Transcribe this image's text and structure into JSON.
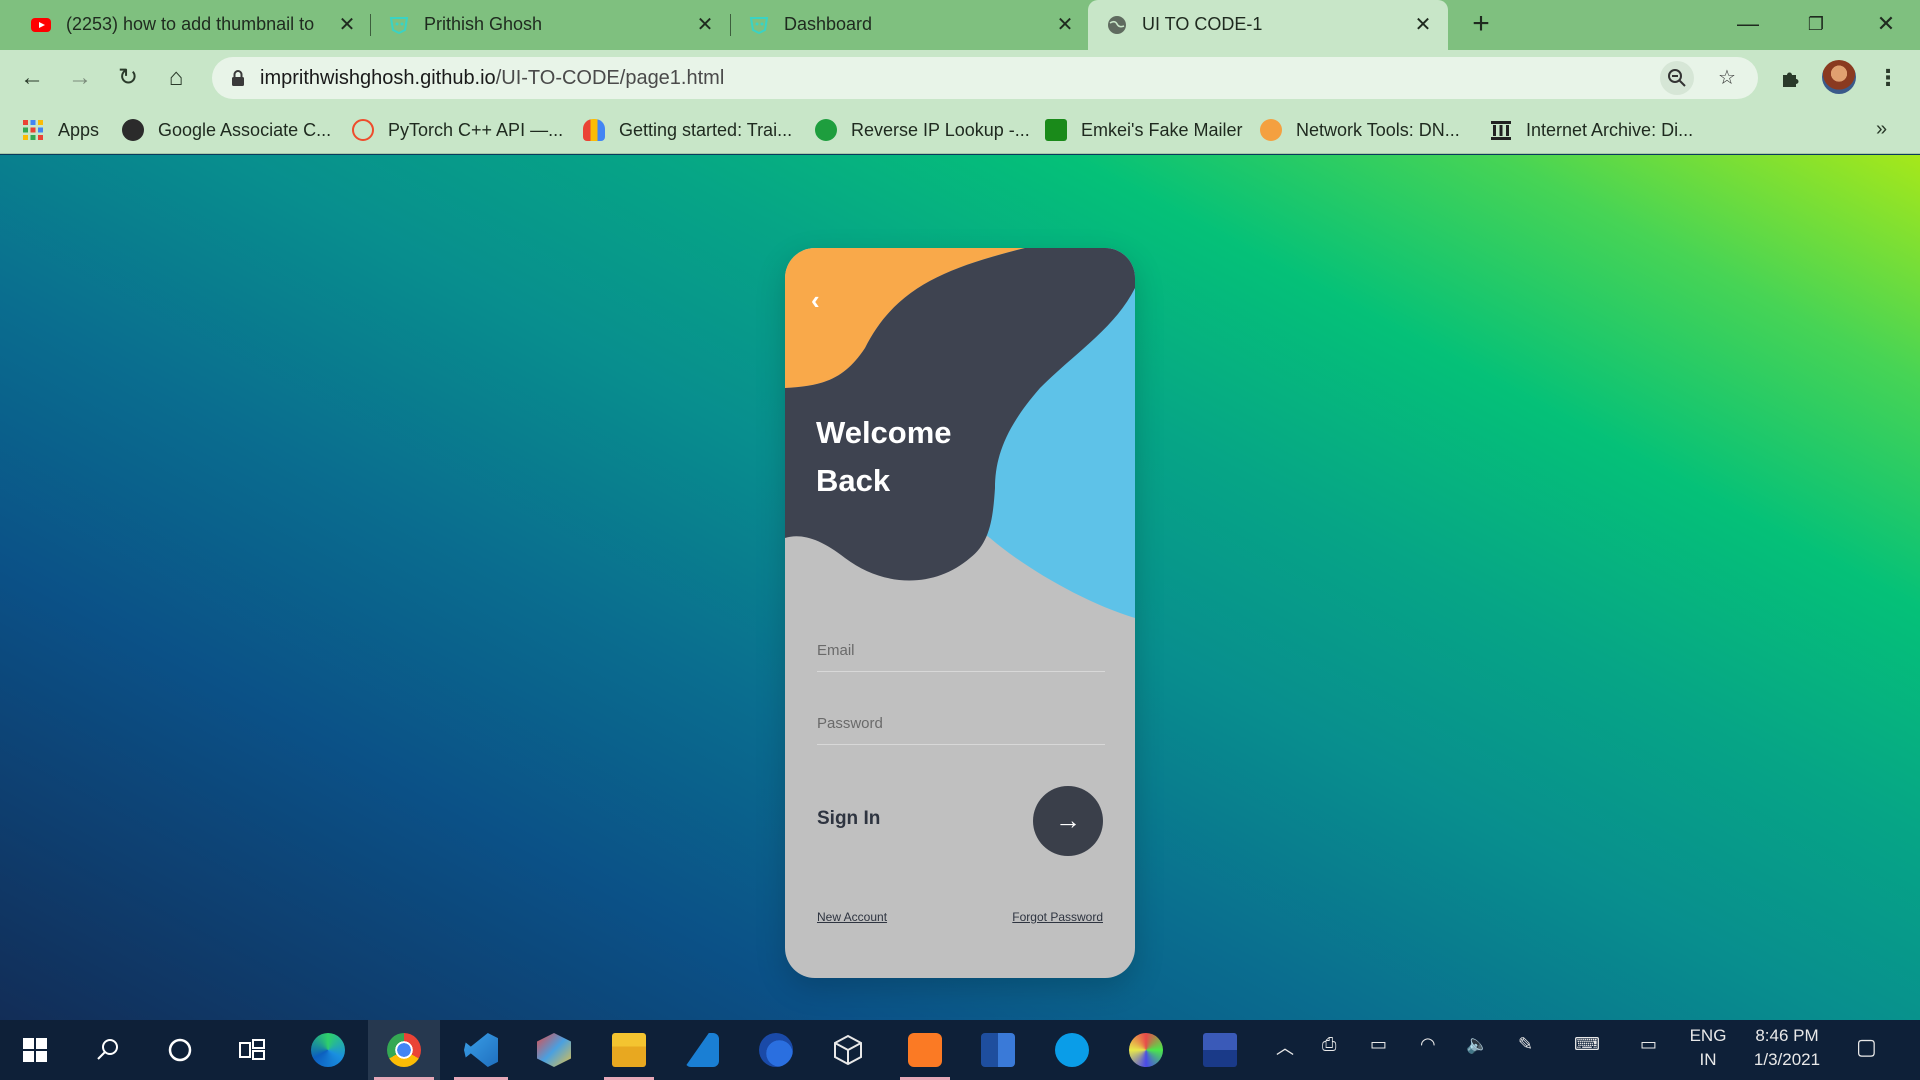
{
  "browser": {
    "tabs": [
      {
        "title": "(2253) how to add thumbnail to",
        "favicon": "youtube-icon",
        "active": false
      },
      {
        "title": "Prithish Ghosh",
        "favicon": "glitch-icon",
        "active": false
      },
      {
        "title": "Dashboard",
        "favicon": "glitch-icon",
        "active": false
      },
      {
        "title": "UI TO CODE-1",
        "favicon": "globe-icon",
        "active": true
      }
    ],
    "url_host": "imprithwishghosh.github.io",
    "url_path": "/UI-TO-CODE/page1.html",
    "bookmarks": [
      {
        "label": "Apps",
        "icon": "apps-grid-icon"
      },
      {
        "label": "Google Associate C...",
        "icon": "globe-icon"
      },
      {
        "label": "PyTorch C++ API —...",
        "icon": "pytorch-icon"
      },
      {
        "label": "Getting started: Trai...",
        "icon": "google-cloud-icon"
      },
      {
        "label": "Reverse IP Lookup -...",
        "icon": "check-badge-icon"
      },
      {
        "label": "Emkei's Fake Mailer",
        "icon": "leaf-icon"
      },
      {
        "label": "Network Tools: DN...",
        "icon": "network-tools-icon"
      },
      {
        "label": "Internet Archive: Di...",
        "icon": "archive-icon"
      }
    ]
  },
  "login": {
    "welcome_line1": "Welcome",
    "welcome_line2": "Back",
    "email_placeholder": "Email",
    "password_placeholder": "Password",
    "signin_label": "Sign In",
    "signin_arrow": "→",
    "back_glyph": "‹",
    "new_account": "New Account",
    "forgot_password": "Forgot Password",
    "colors": {
      "orange": "#f9a94a",
      "dark": "#3e4350",
      "blue": "#5ec2e8",
      "card": "#c0c0c0"
    }
  },
  "taskbar": {
    "lang_top": "ENG",
    "lang_bottom": "IN",
    "time": "8:46 PM",
    "date": "1/3/2021"
  }
}
